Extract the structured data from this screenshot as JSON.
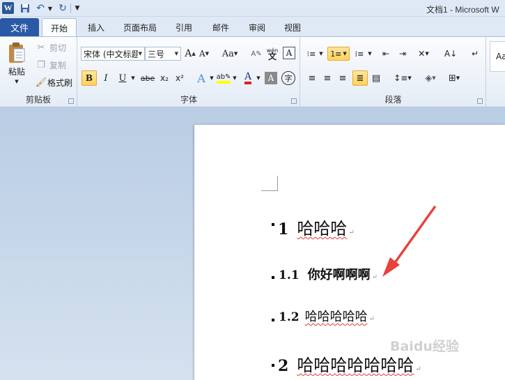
{
  "app": {
    "title": "文档1 - Microsoft W",
    "logo": "W"
  },
  "quick_access": {
    "icons": [
      "word-logo-icon",
      "save-icon",
      "undo-icon",
      "redo-icon",
      "customize-icon"
    ]
  },
  "tabs": {
    "file": "文件",
    "items": [
      "开始",
      "插入",
      "页面布局",
      "引用",
      "邮件",
      "审阅",
      "视图"
    ],
    "active": "开始"
  },
  "ribbon": {
    "clipboard": {
      "label": "剪贴板",
      "paste": "粘贴",
      "cut": "剪切",
      "copy": "复制",
      "format_painter": "格式刷"
    },
    "font": {
      "label": "字体",
      "font_name": "宋体 (中文标题",
      "font_size": "三号",
      "case_btn": "Aa",
      "bold": "B",
      "italic": "I",
      "underline": "U",
      "strike": "abe",
      "subscript": "x₂",
      "superscript": "x²",
      "phonetic": "wén",
      "highlight_color": "#ffff00",
      "font_color": "#e02020"
    },
    "paragraph": {
      "label": "段落"
    },
    "styles": {
      "preview": "Aa"
    }
  },
  "document": {
    "headings": [
      {
        "number": "1",
        "text": "哈哈哈",
        "level": 1
      },
      {
        "number": "1.1",
        "text": "你好啊啊啊",
        "level": 2
      },
      {
        "number": "1.2",
        "text": "哈哈哈哈哈",
        "level": 2
      },
      {
        "number": "2",
        "text": "哈哈哈哈哈哈哈",
        "level": 1
      }
    ],
    "paragraph_mark": "↵"
  },
  "watermark": "Baidu经验",
  "colors": {
    "file_tab": "#2a5aa6",
    "arrow": "#e8423a",
    "selected_button": "#ffd35a"
  }
}
